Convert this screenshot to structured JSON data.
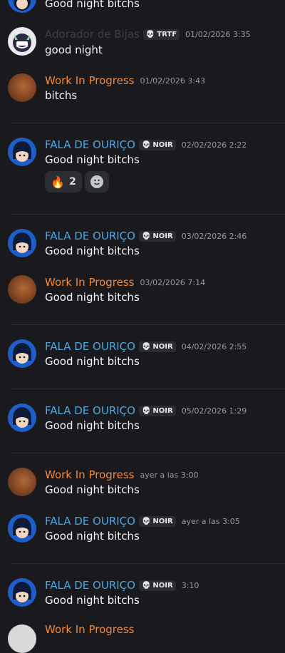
{
  "messages": [
    {
      "id": "m0",
      "author": "",
      "text": "Good night bitchs",
      "tag": "",
      "time": ""
    },
    {
      "id": "m1",
      "author": "Adorador de Bijas",
      "tag": "TRTF",
      "time": "01/02/2026 3:35",
      "text": "good night"
    },
    {
      "id": "m2",
      "author": "Work In Progress",
      "tag": "",
      "time": "01/02/2026 3:43",
      "text": "bitchs"
    },
    {
      "id": "m3",
      "author": "FALA DE OURIÇO",
      "tag": "NOIR",
      "time": "02/02/2026 2:22",
      "text": "Good night bitchs"
    },
    {
      "id": "m4",
      "author": "FALA DE OURIÇO",
      "tag": "NOIR",
      "time": "03/02/2026 2:46",
      "text": "Good night bitchs"
    },
    {
      "id": "m5",
      "author": "Work In Progress",
      "tag": "",
      "time": "03/02/2026 7:14",
      "text": "Good night bitchs"
    },
    {
      "id": "m6",
      "author": "FALA DE OURIÇO",
      "tag": "NOIR",
      "time": "04/02/2026 2:55",
      "text": "Good night bitchs"
    },
    {
      "id": "m7",
      "author": "FALA DE OURIÇO",
      "tag": "NOIR",
      "time": "05/02/2026 1:29",
      "text": "Good night bitchs"
    },
    {
      "id": "m8",
      "author": "Work In Progress",
      "tag": "",
      "time": "ayer a las 3:00",
      "text": "Good night bitchs"
    },
    {
      "id": "m9",
      "author": "FALA DE OURIÇO",
      "tag": "NOIR",
      "time": "ayer a las 3:05",
      "text": "Good night bitchs"
    },
    {
      "id": "m10",
      "author": "FALA DE OURIÇO",
      "tag": "NOIR",
      "time": "3:10",
      "text": "Good night bitchs"
    },
    {
      "id": "m11",
      "author": "Work In Progress",
      "tag": "",
      "time": "",
      "text": ""
    }
  ],
  "reactions": {
    "fire": {
      "emoji": "🔥",
      "count": "2",
      "icon": "fire-emoji"
    },
    "add": {
      "icon": "add-reaction-icon"
    }
  },
  "colors": {
    "background": "#1a1a1e",
    "blue_name": "#4aa8e0",
    "orange_name": "#f0893a",
    "timestamp": "#949ba4"
  }
}
